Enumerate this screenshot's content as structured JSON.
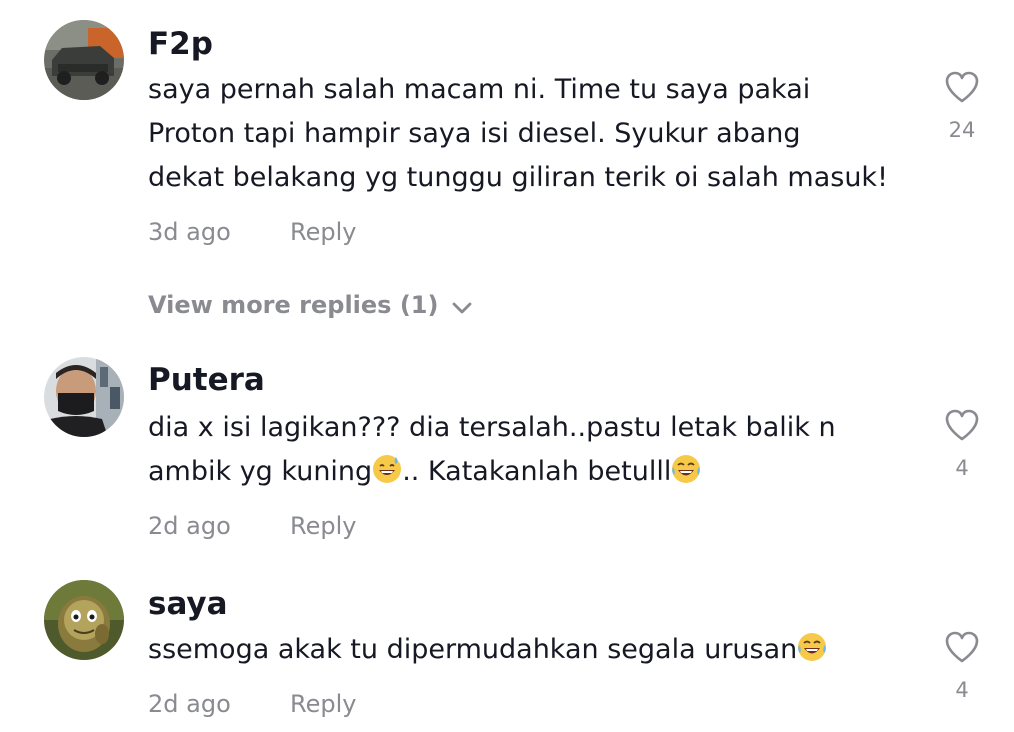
{
  "comments": [
    {
      "username": "F2p",
      "text": "saya pernah salah macam ni. Time tu saya pakai\nProton tapi hampir saya isi diesel. Syukur abang\ndekat belakang yg tunggu giliran terik oi salah masuk!",
      "time": "3d ago",
      "reply_label": "Reply",
      "like_count": "24",
      "view_more": "View more replies (1)"
    },
    {
      "username": "Putera",
      "text_line1": "dia x isi lagikan??? dia tersalah..pastu letak balik n",
      "text_line2a": "ambik yg kuning",
      "text_line2b": ".. Katakanlah betulll",
      "time": "2d ago",
      "reply_label": "Reply",
      "like_count": "4"
    },
    {
      "username": "saya",
      "text": "ssemoga akak tu dipermudahkan segala urusan",
      "time": "2d ago",
      "reply_label": "Reply",
      "like_count": "4"
    }
  ],
  "icons": {
    "like": "heart-outline-icon",
    "expand": "chevron-down-icon",
    "emoji_sweat": "grinning-sweat-emoji",
    "emoji_laugh": "tears-of-joy-emoji"
  },
  "colors": {
    "primary_text": "#161823",
    "secondary_text": "#8a8b91",
    "background": "#ffffff"
  }
}
